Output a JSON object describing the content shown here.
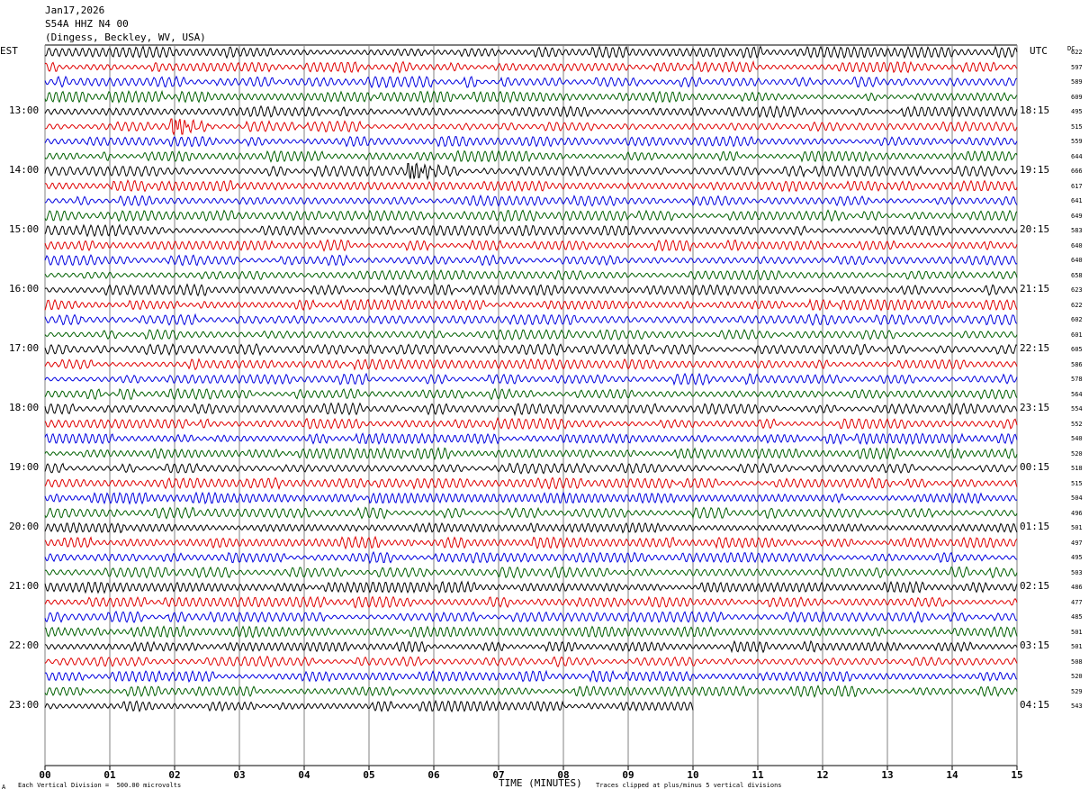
{
  "header": {
    "date": "Jan17,2026",
    "station": "S54A HHZ N4 00",
    "location": "(Dingess, Beckley, WV, USA)"
  },
  "left_axis_title": "EST",
  "right_axis_title": "UTC",
  "dc_title": "DC",
  "footer": {
    "scale_note": "Each Vertical Division =  500.00 microvolts",
    "x_title": "TIME (MINUTES)",
    "clip_note": "Traces clipped at plus/minus 5 vertical divisions",
    "corner_mark": "A"
  },
  "colors": {
    "trace_cycle": [
      "#000000",
      "#e00000",
      "#0000e0",
      "#006000"
    ],
    "grid": "#808080"
  },
  "chart_data": {
    "type": "line",
    "description_kind": "helicorder",
    "x_ticks": [
      "00",
      "01",
      "02",
      "03",
      "04",
      "05",
      "06",
      "07",
      "08",
      "09",
      "10",
      "11",
      "12",
      "13",
      "14",
      "15"
    ],
    "xlim": [
      0,
      15
    ],
    "line_minutes": 15,
    "est_labels": [
      "13:00",
      "14:00",
      "15:00",
      "16:00",
      "17:00",
      "18:00",
      "19:00",
      "20:00",
      "21:00",
      "22:00",
      "23:00"
    ],
    "utc_labels": [
      "18:15",
      "19:15",
      "20:15",
      "21:15",
      "22:15",
      "23:15",
      "00:15",
      "01:15",
      "02:15",
      "03:15",
      "04:15"
    ],
    "label_rows": [
      4,
      8,
      12,
      16,
      20,
      24,
      28,
      32,
      36,
      40,
      44
    ],
    "dc_offsets": [
      622,
      597,
      589,
      609,
      495,
      515,
      559,
      644,
      666,
      617,
      641,
      649,
      583,
      640,
      640,
      658,
      623,
      622,
      602,
      601,
      605,
      586,
      578,
      564,
      554,
      552,
      540,
      520,
      518,
      515,
      504,
      496,
      501,
      497,
      495,
      503,
      486,
      477,
      485,
      501,
      501,
      508,
      520,
      529,
      543
    ],
    "last_row_end_minute": 10,
    "events": [
      {
        "row": 5,
        "minute": 2.0,
        "label": ""
      },
      {
        "row": 8,
        "minute": 5.65,
        "label": ""
      }
    ]
  }
}
